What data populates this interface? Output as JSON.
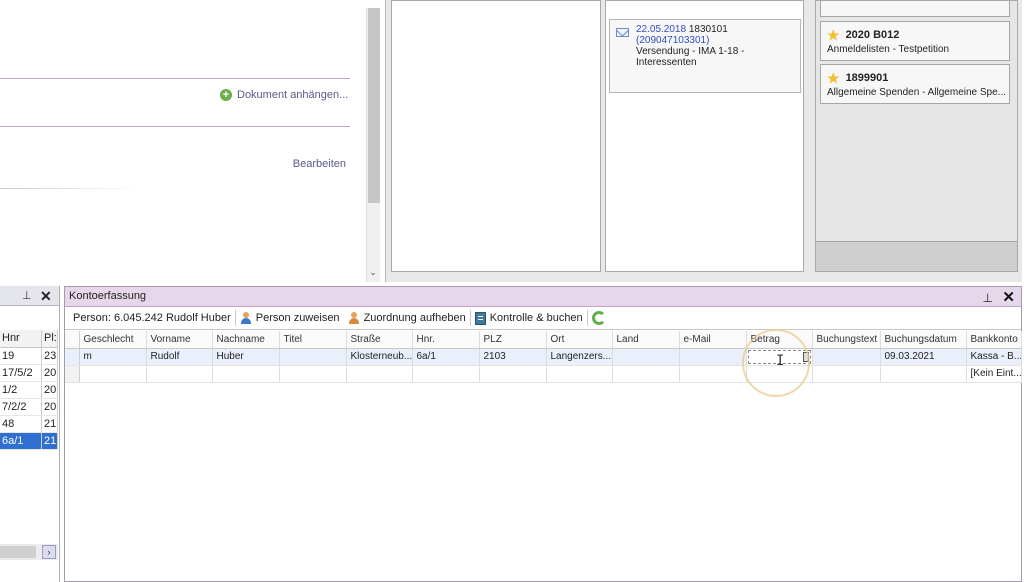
{
  "document_panel": {
    "attach_label": "Dokument anhängen...",
    "edit_label": "Bearbeiten"
  },
  "mail_card": {
    "date": "22.05.2018",
    "number": "1830101",
    "ref": "(209047103301)",
    "description": "Versendung - IMA 1-18 - Interessenten"
  },
  "favorites": [
    {
      "title": "2020 B012",
      "subtitle": "Anmeldelisten - Testpetition"
    },
    {
      "title": "1899901",
      "subtitle": "Allgemeine Spenden - Allgemeine Spe..."
    }
  ],
  "left_panel": {
    "columns": [
      "Hnr",
      "Pl:"
    ],
    "rows": [
      [
        "19",
        "23"
      ],
      [
        "17/5/2",
        "20"
      ],
      [
        "1/2",
        "20"
      ],
      [
        "7/2/2",
        "20"
      ],
      [
        "48",
        "21"
      ],
      [
        "6a/1",
        "21"
      ]
    ],
    "selected_index": 5
  },
  "kontoerfassung": {
    "title": "Kontoerfassung",
    "person_label": "Person:  6.045.242 Rudolf Huber",
    "assign_person": "Person zuweisen",
    "remove_assignment": "Zuordnung aufheben",
    "check_and_book": "Kontrolle & buchen",
    "columns": [
      "Geschlecht",
      "Vorname",
      "Nachname",
      "Titel",
      "Straße",
      "Hnr.",
      "PLZ",
      "Ort",
      "Land",
      "e-Mail",
      "Betrag",
      "Buchungstext",
      "Buchungsdatum",
      "Bankkonto"
    ],
    "rows": [
      [
        "m",
        "Rudolf",
        "Huber",
        "",
        "Klosterneub...",
        "6a/1",
        "2103",
        "Langenzers...",
        "",
        "",
        "",
        "",
        "09.03.2021",
        "Kassa - B..."
      ],
      [
        "",
        "",
        "",
        "",
        "",
        "",
        "",
        "",
        "",
        "",
        "",
        "",
        "",
        "[Kein Eint..."
      ]
    ],
    "editing_column": "Betrag"
  },
  "colors": {
    "panel_header": "#e6d8ea",
    "selection": "#2f6fd0",
    "link": "#5a5a8a"
  }
}
